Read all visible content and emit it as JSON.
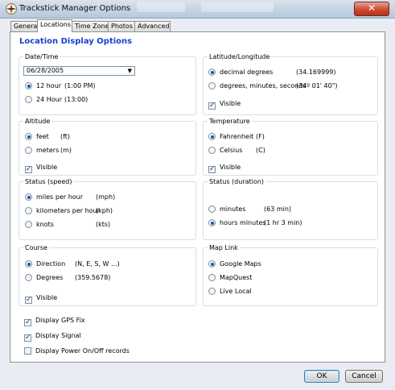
{
  "window": {
    "title": "Trackstick Manager Options",
    "close_glyph": "✕"
  },
  "tabs": [
    {
      "label": "General",
      "active": false
    },
    {
      "label": "Locations",
      "active": true
    },
    {
      "label": "Time Zone",
      "active": false
    },
    {
      "label": "Photos",
      "active": false
    },
    {
      "label": "Advanced",
      "active": false
    }
  ],
  "page_heading": "Location Display Options",
  "date_time": {
    "legend": "Date/Time",
    "date_value": "06/28/2005",
    "options": [
      {
        "label": "12 hour",
        "example": "(1:00 PM)",
        "selected": true
      },
      {
        "label": "24 Hour",
        "example": "(13:00)",
        "selected": false
      }
    ]
  },
  "lat_long": {
    "legend": "Latitude/Longitude",
    "options": [
      {
        "label": "decimal degrees",
        "example": "(34.169999)",
        "selected": true
      },
      {
        "label": "degrees, minutes, seconds",
        "example": "(34º 01' 40\")",
        "selected": false
      }
    ],
    "visible_label": "Visible",
    "visible_checked": true
  },
  "altitude": {
    "legend": "Altitude",
    "options": [
      {
        "label": "feet",
        "example": "(ft)",
        "selected": true
      },
      {
        "label": "meters",
        "example": "(m)",
        "selected": false
      }
    ],
    "visible_label": "Visible",
    "visible_checked": true
  },
  "temperature": {
    "legend": "Temperature",
    "options": [
      {
        "label": "Fahrenheit",
        "example": "(F)",
        "selected": true
      },
      {
        "label": "Celsius",
        "example": "(C)",
        "selected": false
      }
    ],
    "visible_label": "Visible",
    "visible_checked": true
  },
  "status_speed": {
    "legend": "Status (speed)",
    "options": [
      {
        "label": "miles per hour",
        "example": "(mph)",
        "selected": true
      },
      {
        "label": "kilometers per hour",
        "example": "(kph)",
        "selected": false
      },
      {
        "label": "knots",
        "example": "(kts)",
        "selected": false
      }
    ]
  },
  "status_duration": {
    "legend": "Status (duration)",
    "options": [
      {
        "label": "minutes",
        "example": "(63 min)",
        "selected": false
      },
      {
        "label": "hours minutes",
        "example": "(1 hr 3 min)",
        "selected": true
      }
    ]
  },
  "course": {
    "legend": "Course",
    "options": [
      {
        "label": "Direction",
        "example": "(N, E, S, W ...)",
        "selected": true
      },
      {
        "label": "Degrees",
        "example": "(359.5678)",
        "selected": false
      }
    ],
    "visible_label": "Visible",
    "visible_checked": true
  },
  "map_link": {
    "legend": "Map Link",
    "options": [
      {
        "label": "Google Maps",
        "selected": true
      },
      {
        "label": "MapQuest",
        "selected": false
      },
      {
        "label": "Live Local",
        "selected": false
      }
    ]
  },
  "bottom_checks": [
    {
      "label": "Display GPS Fix",
      "checked": true
    },
    {
      "label": "Display Signal",
      "checked": true
    },
    {
      "label": "Display Power On/Off records",
      "checked": false
    }
  ],
  "buttons": {
    "ok": "OK",
    "cancel": "Cancel"
  }
}
